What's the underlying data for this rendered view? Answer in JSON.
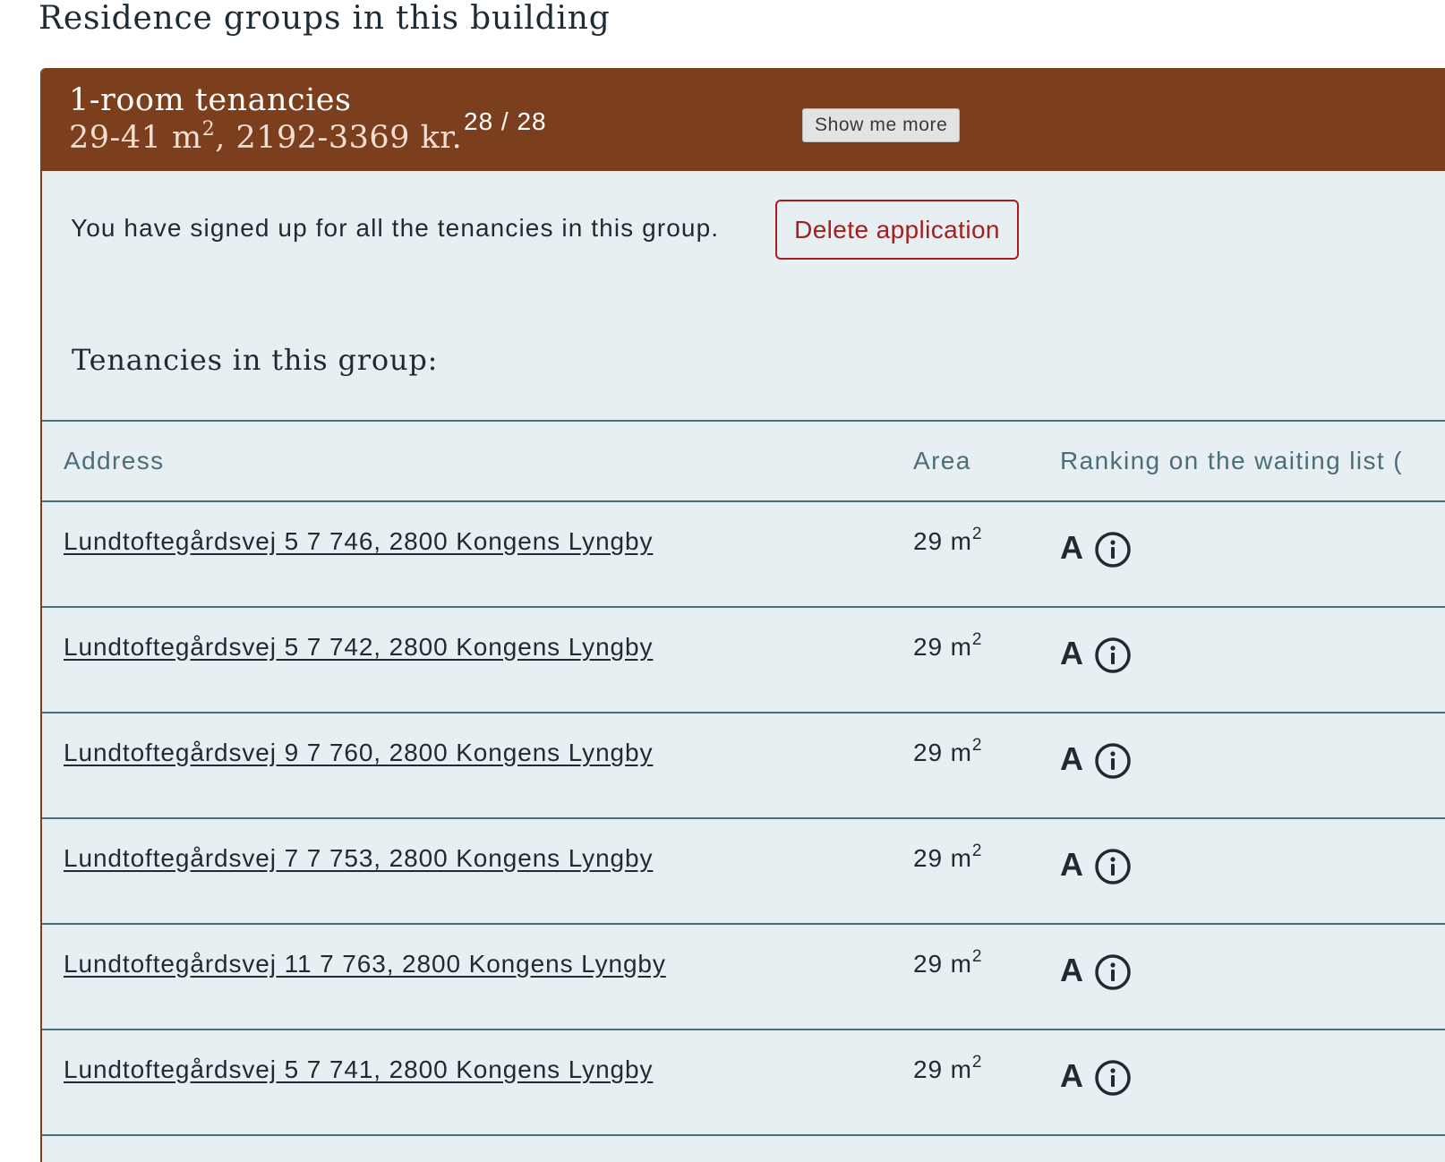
{
  "section_heading": "Residence groups in this building",
  "group": {
    "title": "1-room tenancies",
    "subtitle_prefix": "29-41 m",
    "subtitle_sup": "2",
    "subtitle_suffix": ", 2192-3369 kr.",
    "count": "28 / 28",
    "signup_text": "You have signed up for all the tenancies in this group.",
    "delete_label": "Delete application",
    "tooltip": "Show me more",
    "tenancies_heading": "Tenancies in this group:",
    "columns": {
      "address": "Address",
      "area": "Area",
      "ranking": "Ranking on the waiting list ("
    },
    "rows": [
      {
        "address": "Lundtoftegårdsvej 5 7 746, 2800 Kongens Lyngby",
        "area": "29 m",
        "area_sup": "2",
        "rank": "A",
        "icon": "info-icon"
      },
      {
        "address": "Lundtoftegårdsvej 5 7 742, 2800 Kongens Lyngby",
        "area": "29 m",
        "area_sup": "2",
        "rank": "A",
        "icon": "info-icon"
      },
      {
        "address": "Lundtoftegårdsvej 9 7 760, 2800 Kongens Lyngby",
        "area": "29 m",
        "area_sup": "2",
        "rank": "A",
        "icon": "info-icon"
      },
      {
        "address": "Lundtoftegårdsvej 7 7 753, 2800 Kongens Lyngby",
        "area": "29 m",
        "area_sup": "2",
        "rank": "A",
        "icon": "info-icon"
      },
      {
        "address": "Lundtoftegårdsvej 11 7 763, 2800 Kongens Lyngby",
        "area": "29 m",
        "area_sup": "2",
        "rank": "A",
        "icon": "info-icon"
      },
      {
        "address": "Lundtoftegårdsvej 5 7 741, 2800 Kongens Lyngby",
        "area": "29 m",
        "area_sup": "2",
        "rank": "A",
        "icon": "info-icon"
      }
    ]
  },
  "colors": {
    "header_bg": "#7c3f1e",
    "card_bg": "#e7eff2",
    "delete_red": "#a31f1f",
    "column_header": "#4b6e7a",
    "text": "#1f2b33"
  }
}
